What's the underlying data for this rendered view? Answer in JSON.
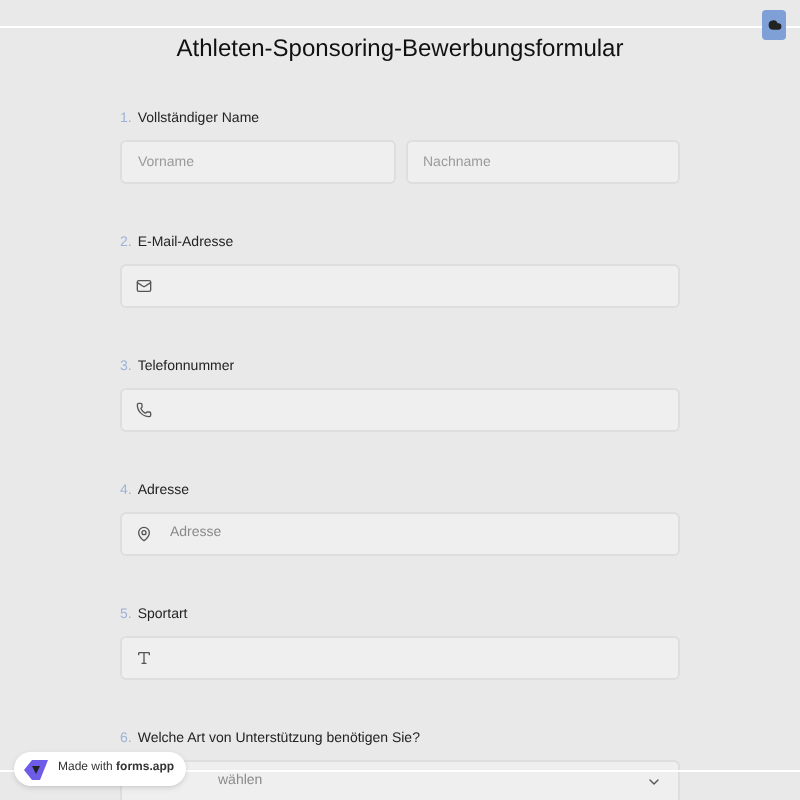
{
  "title": "Athleten-Sponsoring-Bewerbungsformular",
  "questions": [
    {
      "number": "1.",
      "label": "Vollständiger Name",
      "kind": "name",
      "placeholders": [
        "Vorname",
        "Nachname"
      ]
    },
    {
      "number": "2.",
      "label": "E-Mail-Adresse",
      "kind": "email"
    },
    {
      "number": "3.",
      "label": "Telefonnummer",
      "kind": "phone"
    },
    {
      "number": "4.",
      "label": "Adresse",
      "kind": "address",
      "placeholder": "Adresse"
    },
    {
      "number": "5.",
      "label": "Sportart",
      "kind": "text"
    },
    {
      "number": "6.",
      "label": "Welche Art von Unterstützung benötigen Sie?",
      "kind": "select",
      "placeholder": "wählen"
    }
  ],
  "badge": {
    "prefix": "Made with",
    "brand": "forms.app"
  }
}
